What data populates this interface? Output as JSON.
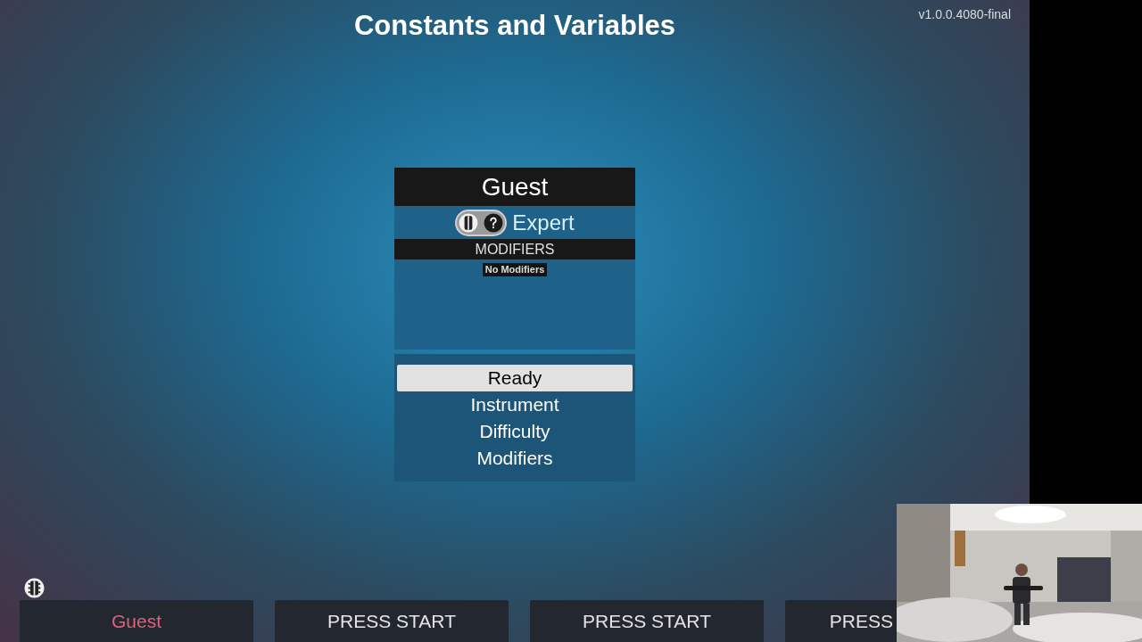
{
  "title": "Constants and Variables",
  "version": "v1.0.0.4080-final",
  "player_card": {
    "name": "Guest",
    "difficulty": "Expert",
    "modifiers_heading": "MODIFIERS",
    "modifiers": [
      "No Modifiers"
    ]
  },
  "menu": [
    {
      "label": "Ready",
      "selected": true
    },
    {
      "label": "Instrument",
      "selected": false
    },
    {
      "label": "Difficulty",
      "selected": false
    },
    {
      "label": "Modifiers",
      "selected": false
    }
  ],
  "player_slots": [
    {
      "label": "Guest",
      "active": true
    },
    {
      "label": "PRESS START",
      "active": false
    },
    {
      "label": "PRESS START",
      "active": false
    },
    {
      "label": "PRESS",
      "active": false
    }
  ]
}
